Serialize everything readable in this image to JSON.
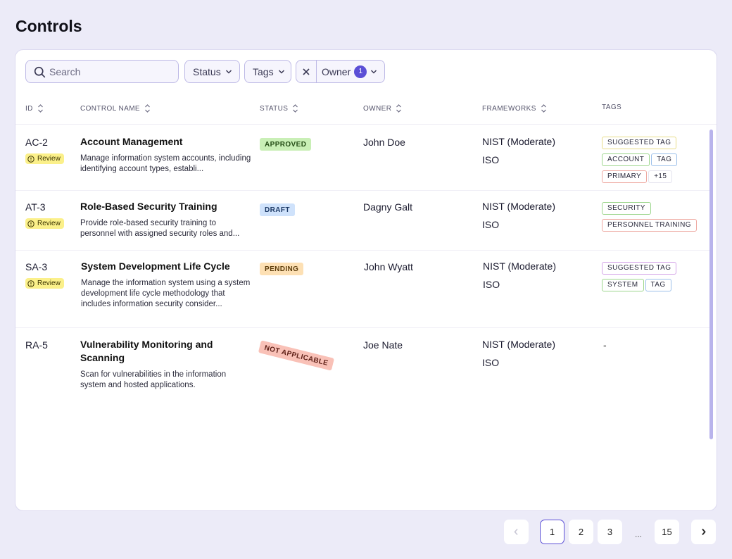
{
  "page": {
    "title": "Controls"
  },
  "filters": {
    "search_placeholder": "Search",
    "status_label": "Status",
    "tags_label": "Tags",
    "owner_label": "Owner",
    "owner_count": "1"
  },
  "table": {
    "headers": {
      "id": "ID",
      "control_name": "CONTROL NAME",
      "status": "STATUS",
      "owner": "OWNER",
      "frameworks": "FRAMEWORKS",
      "tags": "TAGS"
    },
    "rows": [
      {
        "id": "AC-2",
        "badge": "Review",
        "name": "Account Management",
        "description": "Manage information system accounts, including identifying account types, establi...",
        "status": "APPROVED",
        "owner": "John Doe",
        "frameworks": [
          "NIST (Moderate)",
          "ISO"
        ],
        "tags": [
          {
            "label": "SUGGESTED TAG",
            "color": "#e8dd88"
          },
          {
            "label": "ACCOUNT",
            "color": "#9cd68c"
          },
          {
            "label": "TAG",
            "color": "#9cc0ea"
          },
          {
            "label": "PRIMARY",
            "color": "#eea8a0"
          },
          {
            "label": "+15",
            "color": "#e4e3ee"
          }
        ]
      },
      {
        "id": "AT-3",
        "badge": "Review",
        "name": "Role-Based Security Training",
        "description": "Provide role-based security training to personnel with assigned security roles and...",
        "status": "DRAFT",
        "owner": "Dagny Galt",
        "frameworks": [
          "NIST (Moderate)",
          "ISO"
        ],
        "tags": [
          {
            "label": "SECURITY",
            "color": "#9cd68c"
          },
          {
            "label": "PERSONNEL TRAINING",
            "color": "#eea8a0"
          }
        ]
      },
      {
        "id": "SA-3",
        "badge": "Review",
        "name": "System Development Life Cycle",
        "description": "Manage the information system using a system development life cycle methodology that includes information security consider...",
        "status": "PENDING",
        "owner": "John Wyatt",
        "frameworks": [
          "NIST (Moderate)",
          "ISO"
        ],
        "tags": [
          {
            "label": "SUGGESTED TAG",
            "color": "#d4a4e8"
          },
          {
            "label": "SYSTEM",
            "color": "#9cd68c"
          },
          {
            "label": "TAG",
            "color": "#9cc0ea"
          }
        ]
      },
      {
        "id": "RA-5",
        "badge": "",
        "name": "Vulnerability Monitoring and Scanning",
        "description": "Scan for vulnerabilities in the information system and hosted applications.",
        "status": "NOT APPLICABLE",
        "owner": "Joe Nate",
        "frameworks": [
          "NIST (Moderate)",
          "ISO"
        ],
        "tags_empty": "-"
      }
    ]
  },
  "pagination": {
    "pages": [
      "1",
      "2",
      "3"
    ],
    "ellipsis": "...",
    "last_page": "15",
    "current": "1"
  },
  "colors": {
    "accent": "#5b4fd6",
    "approved": "#c9efb6",
    "draft": "#cfe2fb",
    "pending": "#fde0b4",
    "not_applicable": "#f9c1b7",
    "review_badge": "#fbf08a"
  }
}
